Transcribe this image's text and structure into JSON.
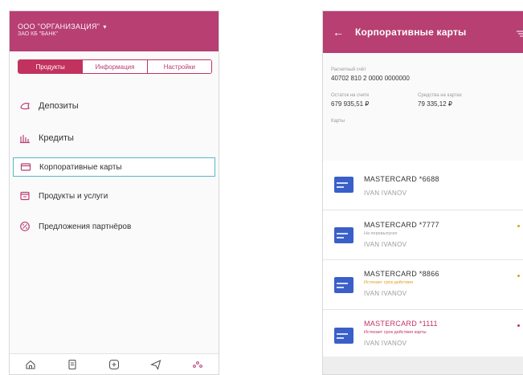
{
  "left_screen": {
    "org_name": "ООО \"ОРГАНИЗАЦИЯ\"",
    "org_bank": "ЗАО КБ \"БАНК\"",
    "tabs": [
      {
        "label": "Продукты",
        "active": true
      },
      {
        "label": "Информация",
        "active": false
      },
      {
        "label": "Настройки",
        "active": false
      }
    ],
    "menu": [
      {
        "label": "Депозиты",
        "icon": "deposit-icon"
      },
      {
        "label": "Кредиты",
        "icon": "credit-icon"
      },
      {
        "label": "Корпоративные карты",
        "icon": "card-icon",
        "selected": true
      },
      {
        "label": "Продукты и услуги",
        "icon": "products-icon"
      },
      {
        "label": "Предложения партнёров",
        "icon": "partner-offers-icon"
      }
    ],
    "bottom_nav": [
      "home-icon",
      "document-icon",
      "add-icon",
      "send-icon",
      "more-icon"
    ]
  },
  "right_screen": {
    "title": "Корпоративные карты",
    "account_label": "Расчетный счёт",
    "account_number": "40702 810 2 0000 0000000",
    "balance_label": "Остаток на счете",
    "balance_value": "679 935,51 ₽",
    "card_funds_label": "Средства на картах",
    "card_funds_value": "79 335,12 ₽",
    "cards_label": "Карты",
    "cards": [
      {
        "name": "MASTERCARD *6688",
        "holder": "IVAN IVANOV",
        "status": "",
        "status_color": ""
      },
      {
        "name": "MASTERCARD *7777",
        "holder": "IVAN IVANOV",
        "status": "На перевыпуске",
        "status_color": "#9a9a9a",
        "dot_color": "#e0a020"
      },
      {
        "name": "MASTERCARD *8866",
        "holder": "IVAN IVANOV",
        "status": "Истекает срок действия",
        "status_color": "#e0a020",
        "dot_color": "#e0a020"
      },
      {
        "name": "MASTERCARD *1111",
        "holder": "IVAN IVANOV",
        "status": "Истекает срок действия карты",
        "status_color": "#c2325f",
        "dot_color": "#c2325f",
        "name_color": "#c2325f"
      }
    ]
  },
  "colors": {
    "brand": "#b73f72",
    "selected_border": "#59b7c6",
    "card_blue": "#3b5fc9"
  }
}
